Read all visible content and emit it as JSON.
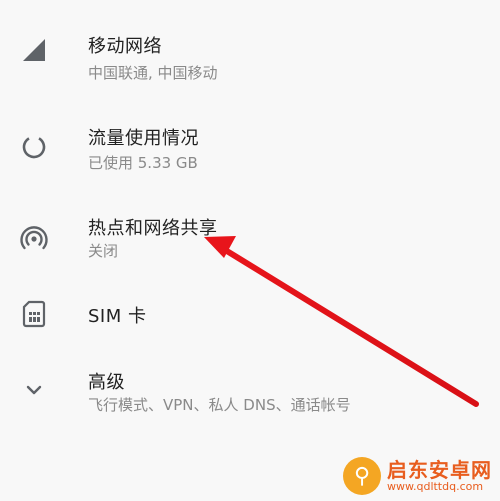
{
  "settings": {
    "items": [
      {
        "icon": "signal-icon",
        "title": "移动网络",
        "summary": "中国联通, 中国移动"
      },
      {
        "icon": "data-usage-icon",
        "title": "流量使用情况",
        "summary": "已使用 5.33 GB"
      },
      {
        "icon": "hotspot-icon",
        "title": "热点和网络共享",
        "summary": "关闭"
      },
      {
        "icon": "sim-card-icon",
        "title": "SIM 卡"
      },
      {
        "icon": "chevron-down-icon",
        "title": "高级",
        "summary": "飞行模式、VPN、私人 DNS、通话帐号"
      }
    ]
  },
  "annotation": {
    "arrow_color": "#e8151b",
    "arrow_target": "热点和网络共享"
  },
  "watermark": {
    "logo_color": "#f4a623",
    "text_color": "#e85d1e",
    "name": "启东安卓网",
    "url": "www.qdlttdq.com"
  }
}
